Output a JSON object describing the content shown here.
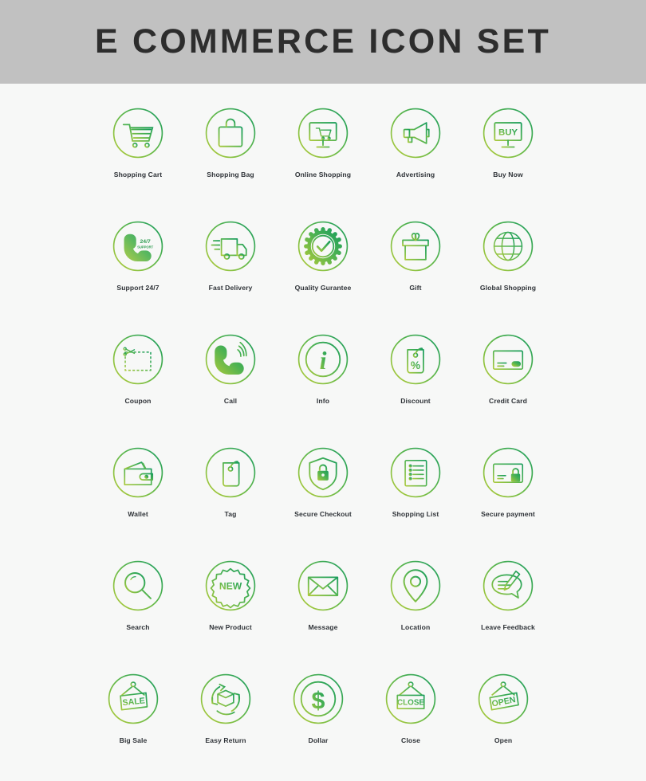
{
  "header": {
    "title": "E COMMERCE ICON SET",
    "band_color": "#c1c1c1",
    "text_color": "#2d2d2d"
  },
  "page": {
    "background_color": "#f7f8f7",
    "label_color": "#2f3338"
  },
  "gradient": {
    "start_color": "#b5cc3a",
    "mid_color": "#6dbb46",
    "end_color": "#169b5f"
  },
  "icon_rows": [
    {
      "row": 1,
      "items": [
        {
          "label": "Shopping Cart",
          "icon": "shopping-cart-icon"
        },
        {
          "label": "Shopping Bag",
          "icon": "shopping-bag-icon"
        },
        {
          "label": "Online Shopping",
          "icon": "online-shopping-monitor-icon"
        },
        {
          "label": "Advertising",
          "icon": "megaphone-icon"
        },
        {
          "label": "Buy Now",
          "icon": "buy-now-monitor-icon",
          "icon_text": "BUY"
        }
      ]
    },
    {
      "row": 2,
      "items": [
        {
          "label": "Support 24/7",
          "icon": "phone-support-icon",
          "icon_text": "24/7",
          "icon_subtext": "SUPPORT"
        },
        {
          "label": "Fast Delivery",
          "icon": "delivery-truck-icon"
        },
        {
          "label": "Quality Gurantee",
          "icon": "quality-badge-check-icon"
        },
        {
          "label": "Gift",
          "icon": "gift-box-icon"
        },
        {
          "label": "Global Shopping",
          "icon": "globe-icon"
        }
      ]
    },
    {
      "row": 3,
      "items": [
        {
          "label": "Coupon",
          "icon": "coupon-scissors-icon"
        },
        {
          "label": "Call",
          "icon": "phone-call-icon"
        },
        {
          "label": "Info",
          "icon": "info-icon",
          "icon_text": "i"
        },
        {
          "label": "Discount",
          "icon": "discount-tag-percent-icon",
          "icon_text": "%"
        },
        {
          "label": "Credit Card",
          "icon": "credit-card-icon"
        }
      ]
    },
    {
      "row": 4,
      "items": [
        {
          "label": "Wallet",
          "icon": "wallet-icon"
        },
        {
          "label": "Tag",
          "icon": "tag-icon"
        },
        {
          "label": "Secure Checkout",
          "icon": "shield-lock-icon"
        },
        {
          "label": "Shopping List",
          "icon": "shopping-list-icon"
        },
        {
          "label": "Secure payment",
          "icon": "card-lock-icon"
        }
      ]
    },
    {
      "row": 5,
      "items": [
        {
          "label": "Search",
          "icon": "search-magnifier-icon"
        },
        {
          "label": "New Product",
          "icon": "new-product-badge-icon",
          "icon_text": "NEW"
        },
        {
          "label": "Message",
          "icon": "envelope-icon"
        },
        {
          "label": "Location",
          "icon": "map-pin-icon"
        },
        {
          "label": "Leave Feedback",
          "icon": "feedback-pencil-bubble-icon"
        }
      ]
    },
    {
      "row": 6,
      "items": [
        {
          "label": "Big Sale",
          "icon": "sale-sign-icon",
          "icon_text": "SALE"
        },
        {
          "label": "Easy Return",
          "icon": "return-box-icon"
        },
        {
          "label": "Dollar",
          "icon": "dollar-icon",
          "icon_text": "$"
        },
        {
          "label": "Close",
          "icon": "close-sign-icon",
          "icon_text": "CLOSE"
        },
        {
          "label": "Open",
          "icon": "open-sign-icon",
          "icon_text": "OPEN"
        }
      ]
    }
  ]
}
